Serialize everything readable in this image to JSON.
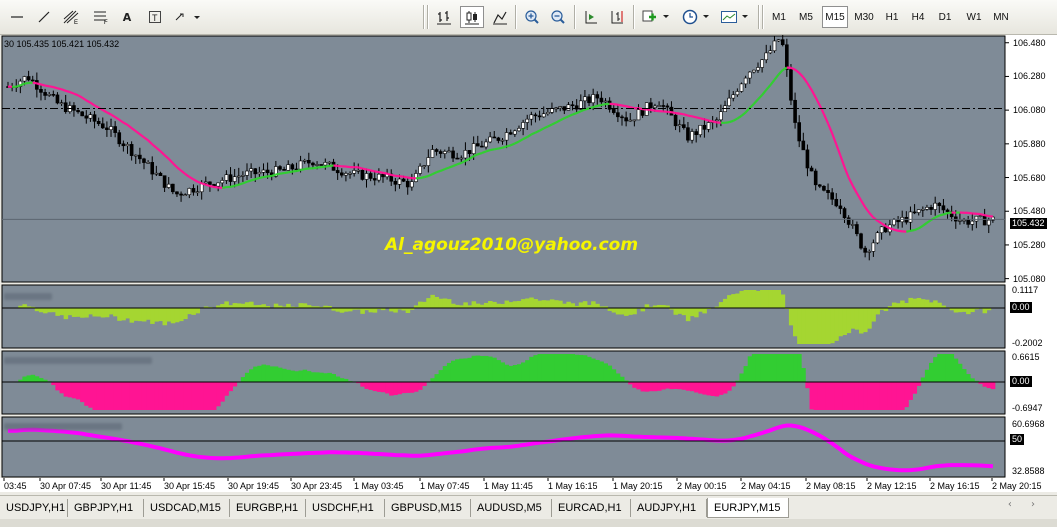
{
  "toolbar": {
    "timeframes": [
      "M1",
      "M5",
      "M15",
      "M30",
      "H1",
      "H4",
      "D1",
      "W1",
      "MN"
    ],
    "selected_timeframe": "M15",
    "text_tool": "A"
  },
  "chart": {
    "ohlc_text": "30 105.435 105.421 105.432",
    "watermark": "Al_agouz2010@yahoo.com",
    "current_price": "105.432",
    "price_labels": [
      "106.480",
      "106.280",
      "106.080",
      "105.880",
      "105.680",
      "105.480",
      "105.280",
      "105.080"
    ],
    "time_labels": [
      "03:45",
      "30 Apr 07:45",
      "30 Apr 11:45",
      "30 Apr 15:45",
      "30 Apr 19:45",
      "30 Apr 23:45",
      "1 May 03:45",
      "1 May 07:45",
      "1 May 11:45",
      "1 May 16:15",
      "1 May 20:15",
      "2 May 00:15",
      "2 May 04:15",
      "2 May 08:15",
      "2 May 12:15",
      "2 May 16:15",
      "2 May 20:15"
    ],
    "subwindow1": {
      "top": "0.1117",
      "zero": "0.00",
      "bottom": "-0.2002"
    },
    "subwindow2": {
      "top": "0.6615",
      "zero": "0.00",
      "bottom": "-0.6947"
    },
    "subwindow3": {
      "top": "60.6968",
      "level": "50",
      "bottom": "32.8588"
    },
    "colors": {
      "background": "#7f8b97",
      "bull_candle": "#ffffff",
      "bear_candle": "#000000",
      "ma_up": "#32cd32",
      "ma_down": "#ff1493",
      "osc1": "#a5d631",
      "osc2_up": "#32cd32",
      "osc2_down": "#ff1493",
      "rsi_line": "#ff00ff",
      "watermark": "#f5f500"
    }
  },
  "tabs": [
    "USDJPY,H1",
    "GBPJPY,H1",
    "USDCAD,M15",
    "EURGBP,H1",
    "USDCHF,H1",
    "GBPUSD,M15",
    "AUDUSD,M5",
    "EURCAD,H1",
    "AUDJPY,H1",
    "EURJPY,M15"
  ],
  "active_tab": "EURJPY,M15"
}
